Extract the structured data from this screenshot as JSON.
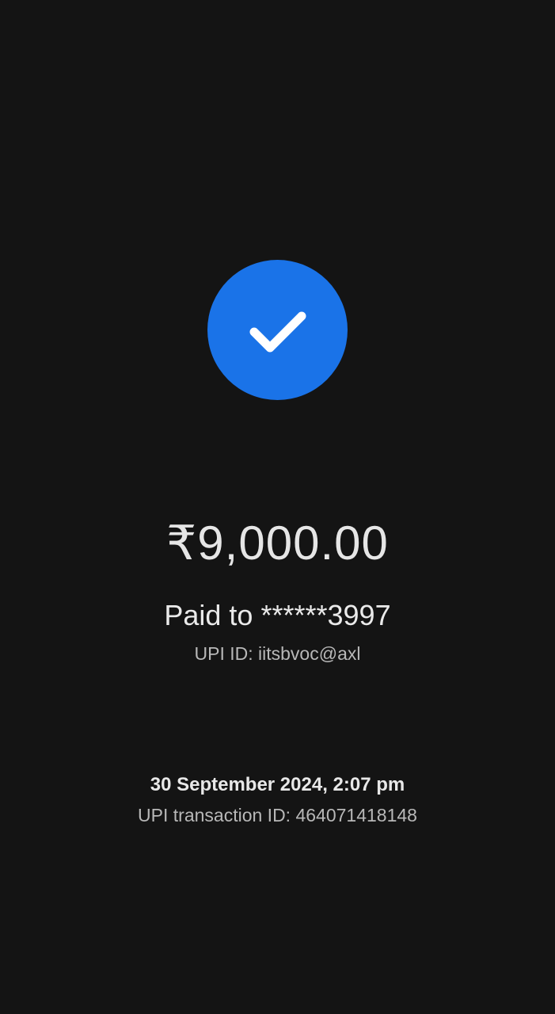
{
  "payment": {
    "status_icon": "check-icon",
    "amount": "₹9,000.00",
    "paid_to": "Paid to ******3997",
    "upi_id": "UPI ID: iitsbvoc@axl",
    "date_time": "30 September 2024, 2:07 pm",
    "transaction_id": "UPI transaction ID: 464071418148"
  },
  "colors": {
    "background": "#141414",
    "accent": "#1a73e8",
    "check": "#ffffff"
  }
}
